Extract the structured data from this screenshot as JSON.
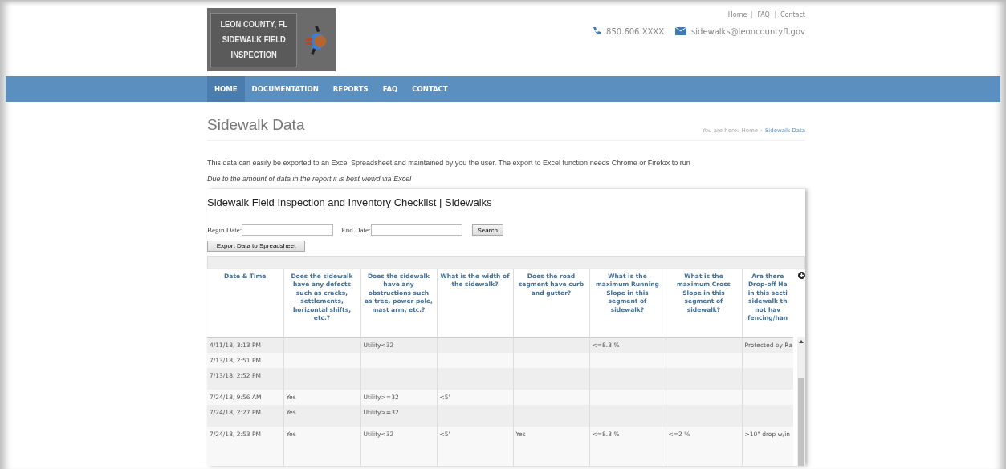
{
  "logo": {
    "lines": [
      "LEON COUNTY, FL",
      "SIDEWALK FIELD",
      "INSPECTION"
    ]
  },
  "top_links": [
    "Home",
    "FAQ",
    "Contact"
  ],
  "contact": {
    "phone": "850.606.XXXX",
    "email": "sidewalks@leoncountyfl.gov"
  },
  "nav": [
    {
      "label": "HOME",
      "selected": true
    },
    {
      "label": "DOCUMENTATION",
      "selected": false
    },
    {
      "label": "REPORTS",
      "selected": false
    },
    {
      "label": "FAQ",
      "selected": false
    },
    {
      "label": "CONTACT",
      "selected": false
    }
  ],
  "page_title": "Sidewalk Data",
  "breadcrumb": {
    "prefix": "You are here:",
    "items": [
      "Home",
      "Sidewalk Data"
    ],
    "separator": "›"
  },
  "intro": "This data can easily be exported to an Excel Spreadsheet and maintained by you the user. The export to Excel function needs Chrome or Firefox to run",
  "note": "Due to the amount of data in the report it is best viewd via Excel",
  "panel": {
    "title": "Sidewalk Field Inspection and Inventory Checklist | Sidewalks",
    "begin_label": "Begin Date:",
    "end_label": "End Date:",
    "search_button": "Search",
    "export_button": "Export Data to Spreadsheet"
  },
  "table": {
    "columns": [
      "Date & Time",
      "Does the sidewalk have any defects such as cracks, settlements, horizontal shifts, etc.?",
      "Does the sidewalk have any obstructions such as tree, power pole, mast arm, etc.?",
      "What is the width of the sidewalk?",
      "Does the road segment have curb and gutter?",
      "What is the maximum Running Slope in this segment of sidewalk?",
      "What is the maximum Cross Slope in this segment of sidewalk?",
      "Are there\nDrop-off Ha\nin this secti\nsidewalk th\nnot hav\nfencing/han"
    ],
    "rows": [
      [
        "4/11/18, 3:13 PM",
        "",
        "Utility<32",
        "",
        "",
        "<=8.3 %",
        "",
        "Protected by Ra"
      ],
      [
        "7/13/18, 2:51 PM",
        "",
        "",
        "",
        "",
        "",
        "",
        ""
      ],
      [
        "7/13/18, 2:52 PM",
        "",
        "",
        "",
        "",
        "",
        "",
        ""
      ],
      [
        "7/24/18, 9:56 AM",
        "Yes",
        "Utility>=32",
        "<5'",
        "",
        "",
        "",
        ""
      ],
      [
        "7/24/18, 2:27 PM",
        "Yes",
        "Utility>=32",
        "",
        "",
        "",
        "",
        ""
      ],
      [
        "7/24/18, 2:53 PM",
        "Yes",
        "Utility<32",
        "<5'",
        "Yes",
        "<=8.3 %",
        "<=2 %",
        ">10\" drop w/in"
      ]
    ]
  }
}
